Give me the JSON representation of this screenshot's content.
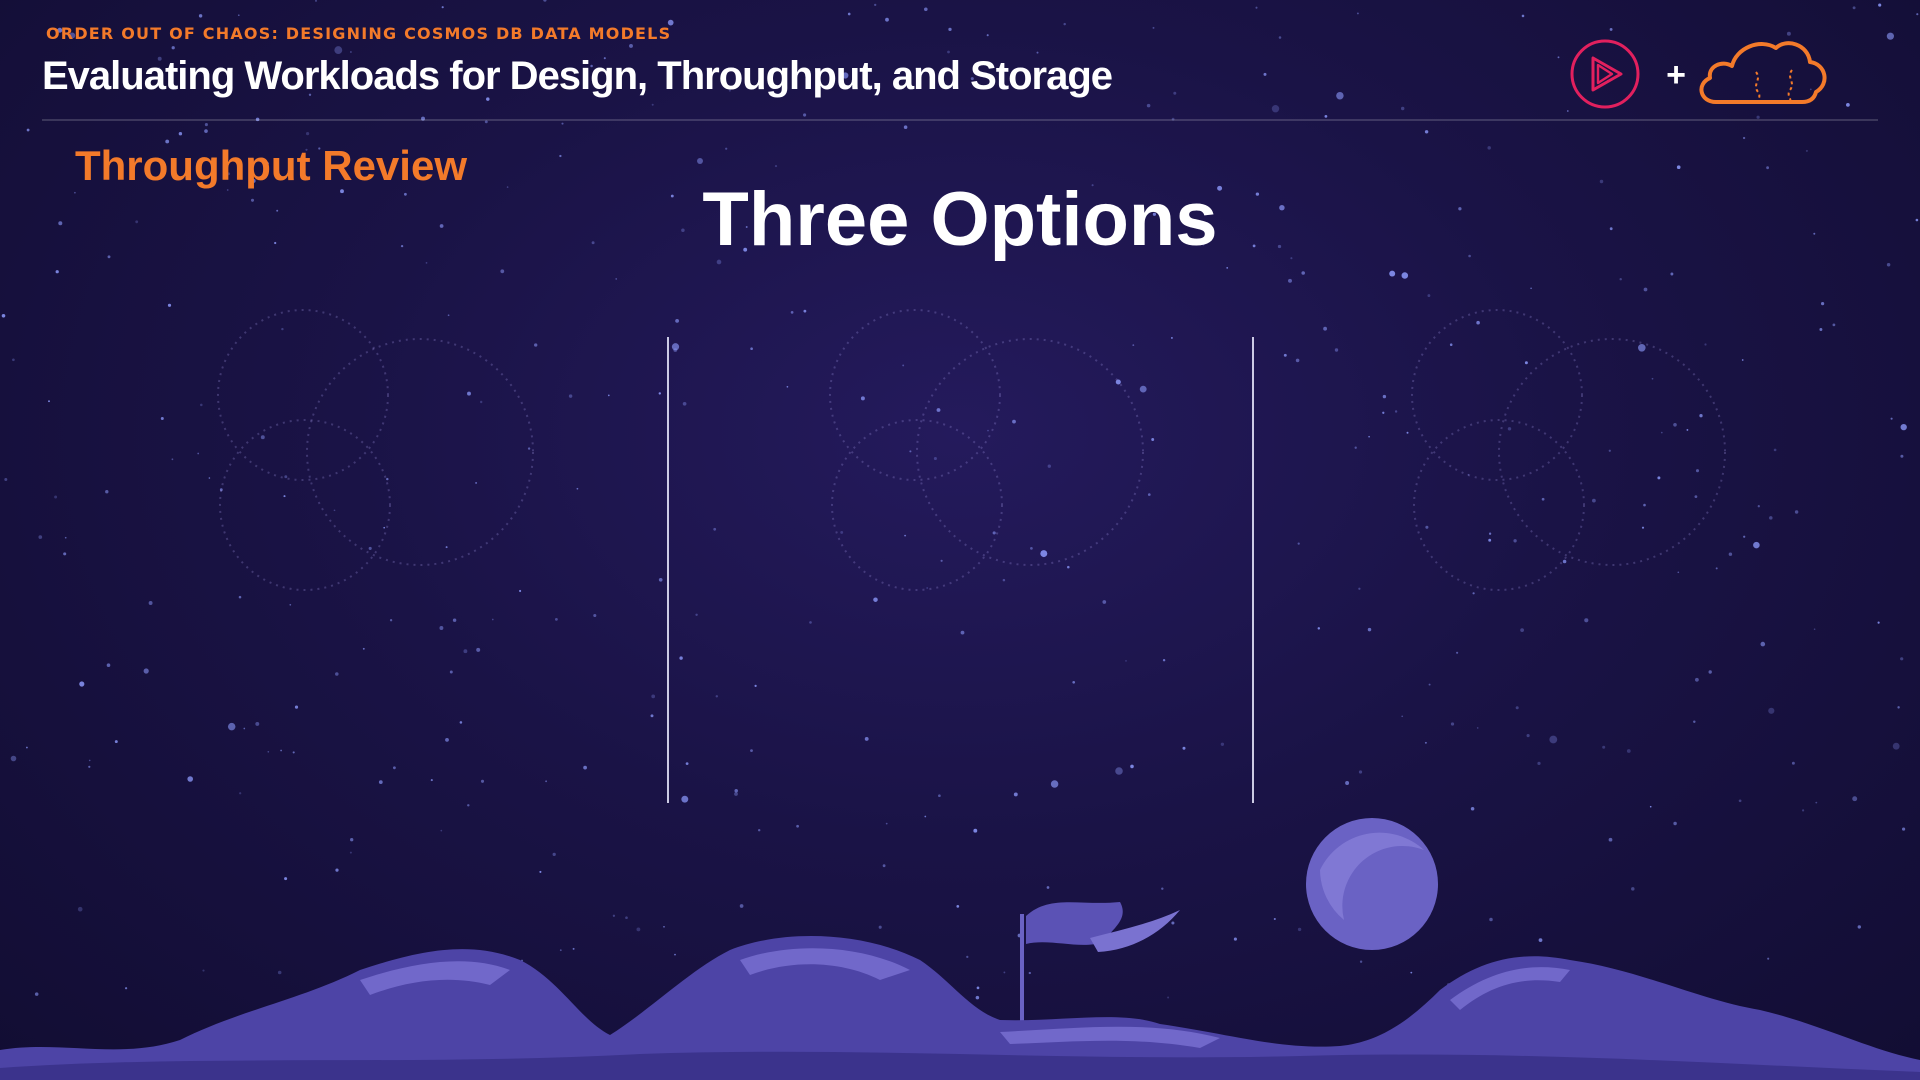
{
  "header": {
    "course_title": "ORDER OUT OF CHAOS: DESIGNING COSMOS DB DATA MODELS",
    "module_title": "Evaluating Workloads for Design, Throughput, and Storage",
    "logos": {
      "left_icon": "play-circle-icon",
      "separator": "+",
      "right_icon": "cloud-icon"
    }
  },
  "slide": {
    "section_title": "Throughput Review",
    "title": "Three Options",
    "columns": [
      {
        "name": "option-1"
      },
      {
        "name": "option-2"
      },
      {
        "name": "option-3"
      }
    ]
  },
  "colors": {
    "accent_orange": "#f37a2a",
    "brand_red": "#e2205e",
    "background": "#1a1346",
    "landscape": "#5b52b5"
  }
}
